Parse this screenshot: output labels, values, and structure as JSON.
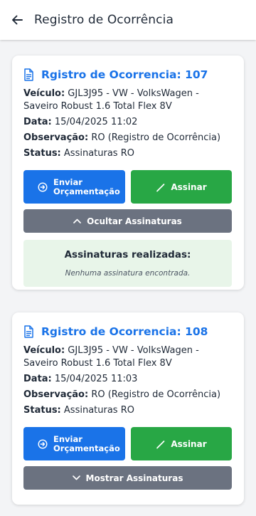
{
  "header": {
    "title": "Registro de Ocorrência"
  },
  "cards": [
    {
      "title": "Rgistro de Ocorrencia: 107",
      "vehicle_label": "Veículo:",
      "vehicle_value": " GJL3J95 - VW - VolksWagen - Saveiro Robust 1.6 Total Flex 8V",
      "date_label": "Data:",
      "date_value": " 15/04/2025 11:02",
      "obs_label": "Observação:",
      "obs_value": " RO (Registro de Ocorrência)",
      "status_label": "Status:",
      "status_value": " Assinaturas RO",
      "send_label_1": "Enviar",
      "send_label_2": "Orçamentação",
      "sign_label": "Assinar",
      "toggle_label": "Ocultar Assinaturas",
      "signatures_title": "Assinaturas realizadas:",
      "signatures_empty": "Nenhuma assinatura encontrada."
    },
    {
      "title": "Rgistro de Ocorrencia: 108",
      "vehicle_label": "Veículo:",
      "vehicle_value": " GJL3J95 - VW - VolksWagen - Saveiro Robust 1.6 Total Flex 8V",
      "date_label": "Data:",
      "date_value": " 15/04/2025 11:03",
      "obs_label": "Observação:",
      "obs_value": " RO (Registro de Ocorrência)",
      "status_label": "Status:",
      "status_value": " Assinaturas RO",
      "send_label_1": "Enviar",
      "send_label_2": "Orçamentação",
      "sign_label": "Assinar",
      "toggle_label": "Mostrar Assinaturas"
    }
  ],
  "colors": {
    "primary": "#1a73e8",
    "success": "#28a745",
    "secondary": "#6b7280",
    "panel": "#e8f5e9"
  },
  "icons": {
    "back": "arrow-left-icon",
    "doc": "document-icon",
    "send": "arrow-circle-right-icon",
    "sign": "pen-icon",
    "hide": "chevron-up-icon",
    "show": "chevron-down-icon"
  }
}
